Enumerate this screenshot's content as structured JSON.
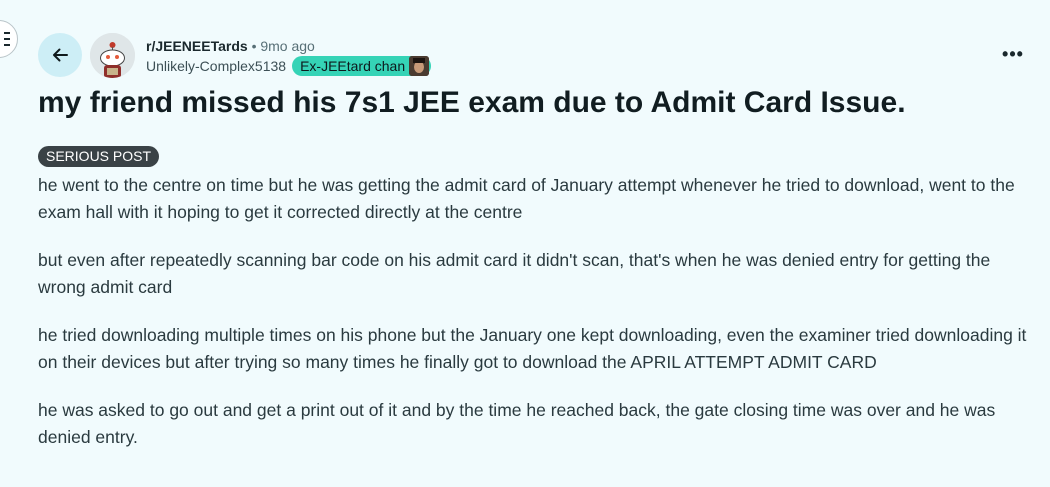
{
  "header": {
    "subreddit": "r/JEENEETards",
    "separator": "•",
    "age": "9mo ago",
    "username": "Unlikely-Complex5138",
    "user_flair": "Ex-JEEtard chan"
  },
  "post": {
    "title": "my friend missed his 7s1 JEE exam due to Admit Card Issue.",
    "flair": "SERIOUS POST",
    "paragraphs": [
      "he went to the centre on time but he was getting the admit card of January attempt whenever he tried to download, went to the exam hall with it hoping to get it corrected directly at the centre",
      "but even after repeatedly scanning bar code on his admit card it didn't scan, that's when he was denied entry for getting the wrong admit card",
      "he tried downloading multiple times on his phone but the January one kept downloading, even the examiner tried downloading it on their devices but after trying so many times he finally got to download the APRIL ATTEMPT ADMIT CARD",
      "he was asked to go out and get a print out of it and by the time he reached back, the gate closing time was over and he was denied entry."
    ]
  },
  "controls": {
    "more": "•••"
  },
  "icons": {
    "back": "arrow-left-icon",
    "menu": "hamburger-menu-icon",
    "avatar": "snoo-avatar",
    "more": "ellipsis-icon"
  },
  "colors": {
    "background": "#f1fbfd",
    "back_button": "#cdeef6",
    "user_flair": "#35d3b6",
    "post_flair": "#3a4246"
  }
}
